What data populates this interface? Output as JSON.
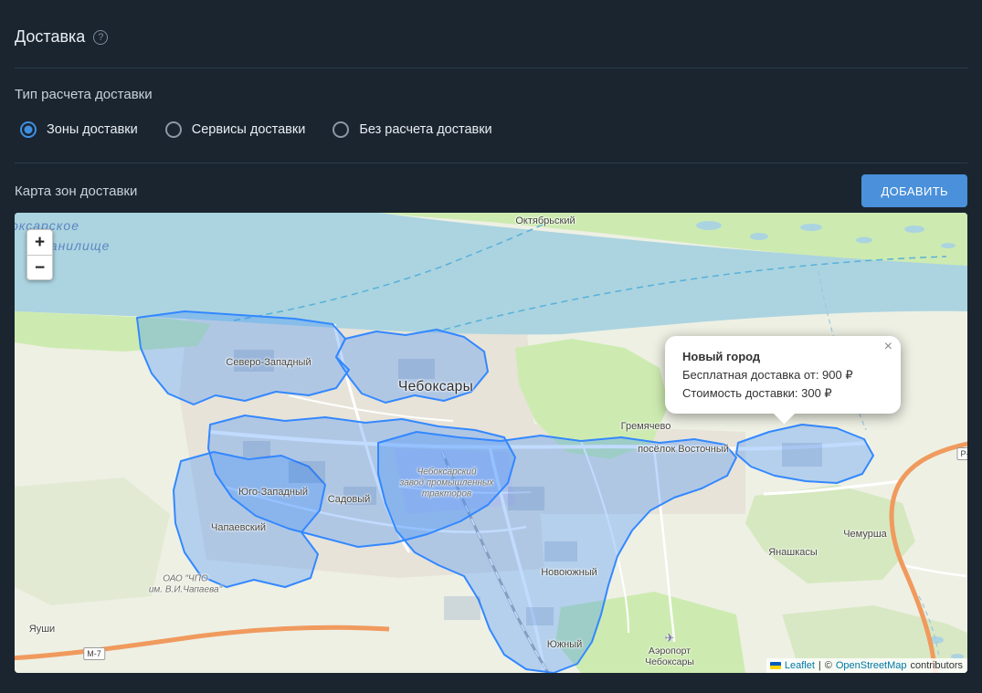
{
  "header": {
    "title": "Доставка",
    "help_glyph": "?"
  },
  "delivery_type": {
    "label": "Тип расчета доставки",
    "options": [
      {
        "label": "Зоны доставки",
        "selected": true
      },
      {
        "label": "Сервисы доставки",
        "selected": false
      },
      {
        "label": "Без расчета доставки",
        "selected": false
      }
    ]
  },
  "zones_map": {
    "label": "Карта зон доставки",
    "add_button_label": "ДОБАВИТЬ"
  },
  "map": {
    "controls": {
      "zoom_in": "+",
      "zoom_out": "−"
    },
    "popup": {
      "title": "Новый город",
      "free_delivery_line": "Бесплатная доставка от: 900 ₽",
      "cost_line": "Стоимость доставки: 300 ₽",
      "close": "×"
    },
    "attribution": {
      "leaflet": "Leaflet",
      "divider": "|",
      "copyright": "©",
      "osm": "OpenStreetMap",
      "suffix": "contributors"
    },
    "labels": [
      {
        "text": "оксарское"
      },
      {
        "text": "хранилище"
      },
      {
        "text": "Октябрьский"
      },
      {
        "text": "Северо-Западный"
      },
      {
        "text": "Чебоксары"
      },
      {
        "text": "Гремячево"
      },
      {
        "text": "посёлок Восточный"
      },
      {
        "text": "Чебоксарский"
      },
      {
        "text": "завод промышленных"
      },
      {
        "text": "тракторов"
      },
      {
        "text": "Юго-Западный"
      },
      {
        "text": "Садовый"
      },
      {
        "text": "Чапаевский"
      },
      {
        "text": "Новоюжный"
      },
      {
        "text": "Южный"
      },
      {
        "text": "Чемурша"
      },
      {
        "text": "Янашкасы"
      },
      {
        "text": "Аэропорт"
      },
      {
        "text": "Чебоксары"
      },
      {
        "text": "ОАО \"ЧПО"
      },
      {
        "text": "им. В.И.Чапаева\""
      },
      {
        "text": "Яуши"
      },
      {
        "text": "М-7"
      },
      {
        "text": "Р-"
      },
      {
        "text": "✈"
      }
    ],
    "colors": {
      "water": "#abd4e0",
      "land": "#eef0e4",
      "forest": "#cdebb0",
      "zone": "#3388ff",
      "accent": "#4a90da"
    }
  }
}
